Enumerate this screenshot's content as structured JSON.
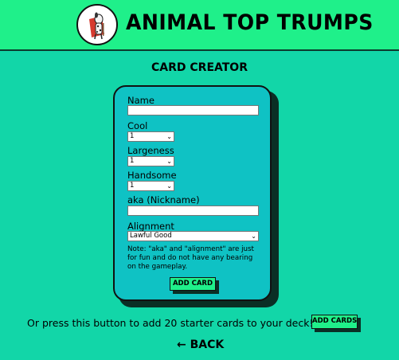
{
  "header": {
    "title": "ANIMAL TOP TRUMPS",
    "logo_icon": "dalmatian-superhero-icon"
  },
  "page_title": "CARD CREATOR",
  "form": {
    "name_label": "Name",
    "name_value": "",
    "cool_label": "Cool",
    "cool_value": "1",
    "largeness_label": "Largeness",
    "largeness_value": "1",
    "handsome_label": "Handsome",
    "handsome_value": "1",
    "aka_label": "aka (Nickname)",
    "aka_value": "",
    "alignment_label": "Alignment",
    "alignment_value": "Lawful Good",
    "note": "Note: \"aka\" and \"alignment\" are just for fun and do not have any bearing on the gameplay.",
    "add_card_label": "ADD CARD"
  },
  "starter": {
    "text": "Or press this button to add 20 starter cards to your deck! →",
    "button_label": "ADD CARDS"
  },
  "back_label": "← BACK",
  "colors": {
    "background": "#12d6a8",
    "header": "#1ff08a",
    "card": "#0fc2c4",
    "button": "#1ff08a",
    "shadow": "#0a2f25"
  }
}
